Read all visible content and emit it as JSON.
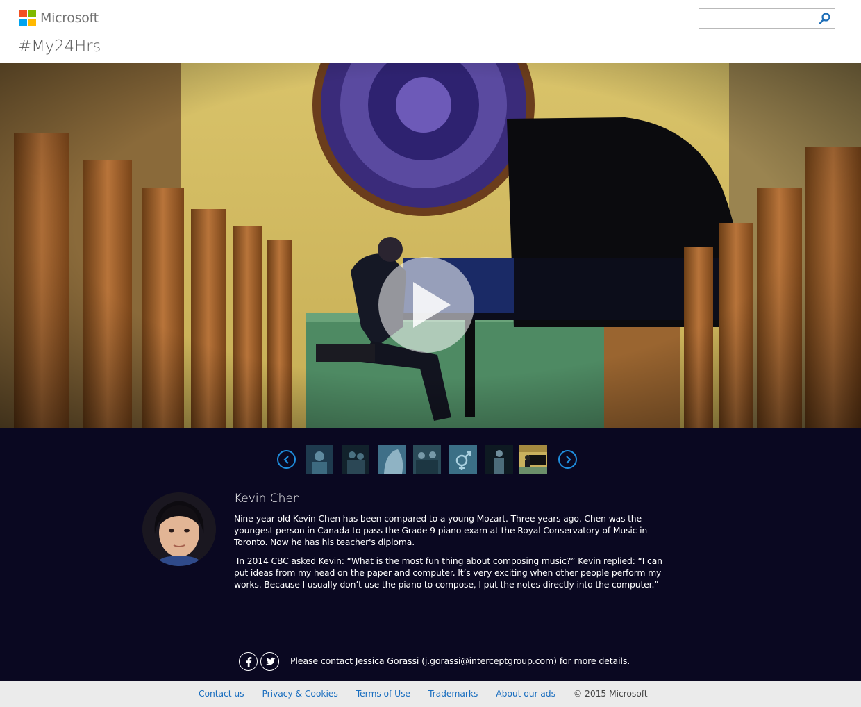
{
  "header": {
    "brand": "Microsoft",
    "page_title": "#My24Hrs",
    "search": {
      "value": "",
      "placeholder": ""
    },
    "logo_colors": [
      "#f25022",
      "#7fba00",
      "#00a4ef",
      "#ffb900"
    ]
  },
  "video": {
    "play_icon": "play-icon",
    "state": "paused"
  },
  "carousel": {
    "prev_icon": "chevron-left-icon",
    "next_icon": "chevron-right-icon",
    "thumbnails": [
      {
        "name": "thumb-1"
      },
      {
        "name": "thumb-2"
      },
      {
        "name": "thumb-3"
      },
      {
        "name": "thumb-4"
      },
      {
        "name": "thumb-5",
        "icon": "gender-symbol-icon"
      },
      {
        "name": "thumb-6"
      },
      {
        "name": "thumb-7",
        "selected": true
      }
    ]
  },
  "profile": {
    "name": "Kevin Chen",
    "paragraph1": "Nine-year-old Kevin Chen has been compared to a young Mozart. Three years ago, Chen was the youngest person in Canada to pass the Grade 9 piano exam at the Royal Conservatory of Music in Toronto. Now he has his teacher's diploma.",
    "paragraph2": " In 2014 CBC asked Kevin: “What is the most fun thing about composing music?” Kevin replied: “I can put ideas from my head on the paper and computer. It’s very exciting when other people perform my works. Because I usually don’t use the piano to compose, I put the notes directly into the computer.”"
  },
  "contact": {
    "prefix": "Please contact Jessica Gorassi (",
    "email": "j.gorassi@interceptgroup.com",
    "suffix": ") for more details.",
    "social": [
      "facebook-icon",
      "twitter-icon"
    ]
  },
  "footer": {
    "links": [
      "Contact us",
      "Privacy & Cookies",
      "Terms of Use",
      "Trademarks",
      "About our ads"
    ],
    "copyright": "© 2015 Microsoft"
  },
  "colors": {
    "accent": "#1f8fe0",
    "dark_bg": "#0a0821",
    "footer_link": "#1a6ebf"
  }
}
